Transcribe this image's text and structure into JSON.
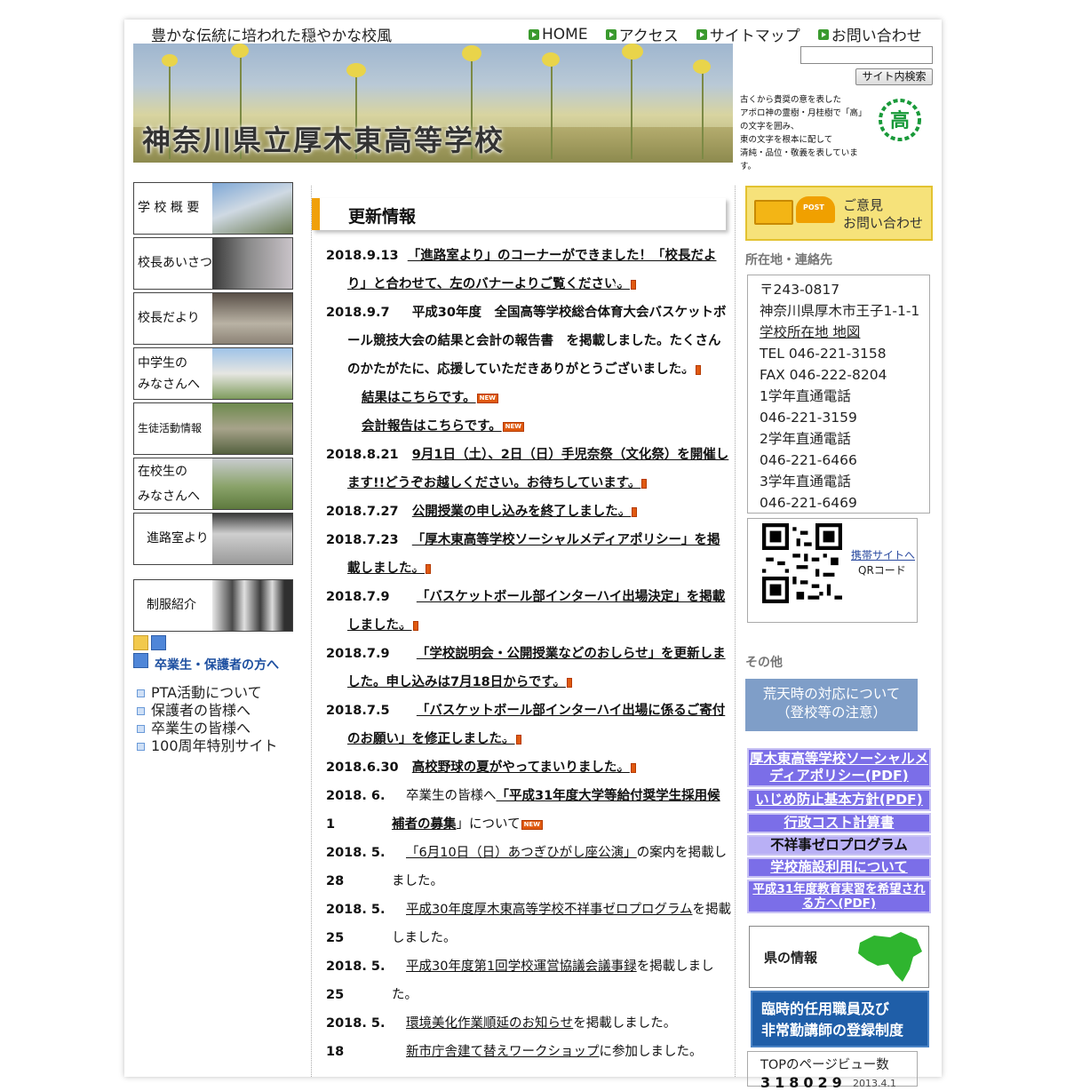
{
  "header": {
    "tagline": "豊かな伝統に培われた穏やかな校風",
    "nav": [
      "HOME",
      "アクセス",
      "サイトマップ",
      "お問い合わせ"
    ],
    "banner_title": "神奈川県立厚木東高等学校",
    "search_button": "サイト内検索",
    "search_value": "",
    "emblem_lines": [
      "古くから貴奨の意を表した",
      "アポロ神の霊樹・月桂樹で「高」",
      "の文字を囲み、",
      "東の文字を根本に配して",
      "清純・品位・敬義を表しています。"
    ],
    "emblem_char": "高"
  },
  "leftnav": [
    {
      "label": "学 校 概 要"
    },
    {
      "label": "校長あいさつ"
    },
    {
      "label": "校長だより"
    },
    {
      "label": "中学生の\nみなさんへ"
    },
    {
      "label": "生徒活動情報"
    },
    {
      "label": "在校生の\nみなさんへ"
    },
    {
      "label": "進路室より"
    },
    {
      "label": "制服紹介"
    }
  ],
  "alumni": {
    "title": "卒業生・保護者の方へ",
    "links": [
      "PTA活動について",
      "保護者の皆様へ",
      "卒業生の皆様へ",
      "100周年特別サイト"
    ]
  },
  "news": {
    "title": "更新情報",
    "new_badge": "NEW",
    "items": [
      {
        "date": "2018.9.13",
        "text": "「進路室より」のコーナーができました！「校長だより」と合わせて、左のバナーよりご覧ください。"
      },
      {
        "date": "2018.9.7",
        "text": "平成30年度　全国高等学校総合体育大会バスケットボール競技大会の結果と会計の報告書　を掲載しました。たくさんのかたがたに、応援していただきありがとうございました。"
      },
      {
        "date": "",
        "text": "結果はこちらです。"
      },
      {
        "date": "",
        "text": "会計報告はこちらです。"
      },
      {
        "date": "2018.8.21",
        "text": "9月1日（土）、2日（日）手児奈祭（文化祭）を開催します!!どうぞお越しください。お待ちしています。"
      },
      {
        "date": "2018.7.27",
        "text": "公開授業の申し込みを終了しました。"
      },
      {
        "date": "2018.7.23",
        "text": "「厚木東高等学校ソーシャルメディアポリシー」を掲載しました。"
      },
      {
        "date": "2018.7.9",
        "text": "「バスケットボール部インターハイ出場決定」を掲載しました。"
      },
      {
        "date": "2018.7.9",
        "text": "「学校説明会・公開授業などのおしらせ」を更新しました。申し込みは7月18日からです。"
      },
      {
        "date": "2018.7.5",
        "text": "「バスケットボール部インターハイ出場に係るご寄付のお願い」を修正しました。"
      },
      {
        "date": "2018.6.30",
        "text": "高校野球の夏がやってまいりました。"
      },
      {
        "date": "2018. 6. 1",
        "text_pre": "卒業生の皆様へ",
        "text_link": "「平成31年度大学等給付奨学生採用候補者の募集",
        "text_post": "」について"
      },
      {
        "date": "2018. 5. 28",
        "text_link": "「6月10日（日）あつぎひがし座公演」",
        "text_post": "の案内を掲載しました。"
      },
      {
        "date": "2018. 5. 25",
        "text_link": "平成30年度厚木東高等学校不祥事ゼロプログラム",
        "text_post": "を掲載しました。"
      },
      {
        "date": "2018. 5. 25",
        "text_link": "平成30年度第1回学校運営協議会議事録",
        "text_post": "を掲載しました。"
      },
      {
        "date": "2018. 5. 18",
        "text_link": "環境美化作業順延のお知らせ",
        "text_post": "を掲載しました。"
      },
      {
        "date": "",
        "text_link": "新市庁舎建て替えワークショップ",
        "text_post": "に参加しました。"
      }
    ]
  },
  "right": {
    "opinion_line1": "ご意見",
    "opinion_line2": "お問い合わせ",
    "post_label": "POST",
    "address_head": "所在地・連絡先",
    "contact_lines": [
      "〒243-0817",
      "神奈川県厚木市王子1-1-1",
      "学校所在地 地図",
      "TEL 046-221-3158",
      "FAX 046-222-8204",
      "1学年直通電話",
      "046-221-3159",
      "2学年直通電話",
      "046-221-6466",
      "3学年直通電話",
      "046-221-6469"
    ],
    "mobile_link": "携帯サイトへ",
    "qr_label": "QRコード",
    "other_head": "その他",
    "weather_line1": "荒天時の対応について",
    "weather_line2": "（登校等の注意）",
    "links": [
      "厚木東高等学校ソーシャルメディアポリシー(PDF)",
      "いじめ防止基本方針(PDF)",
      "行政コスト計算書",
      "不祥事ゼロプログラム",
      "学校施設利用について",
      "平成31年度教育実習を希望される方へ(PDF)"
    ],
    "pref_label": "県の情報",
    "recruit_line1": "臨時的任用職員及び",
    "recruit_line2": "非常勤講師の登録制度",
    "pageview_label": "TOPのページビュー数",
    "pageview_count": "318029",
    "pageview_since": "2013.4.1"
  },
  "colors": {
    "accent": "#f0a00a",
    "link_block": "#7b6ee8",
    "weather": "#7f9ec8",
    "recruit": "#1f5ea8",
    "nav_arrow": "#3a9a2e"
  }
}
